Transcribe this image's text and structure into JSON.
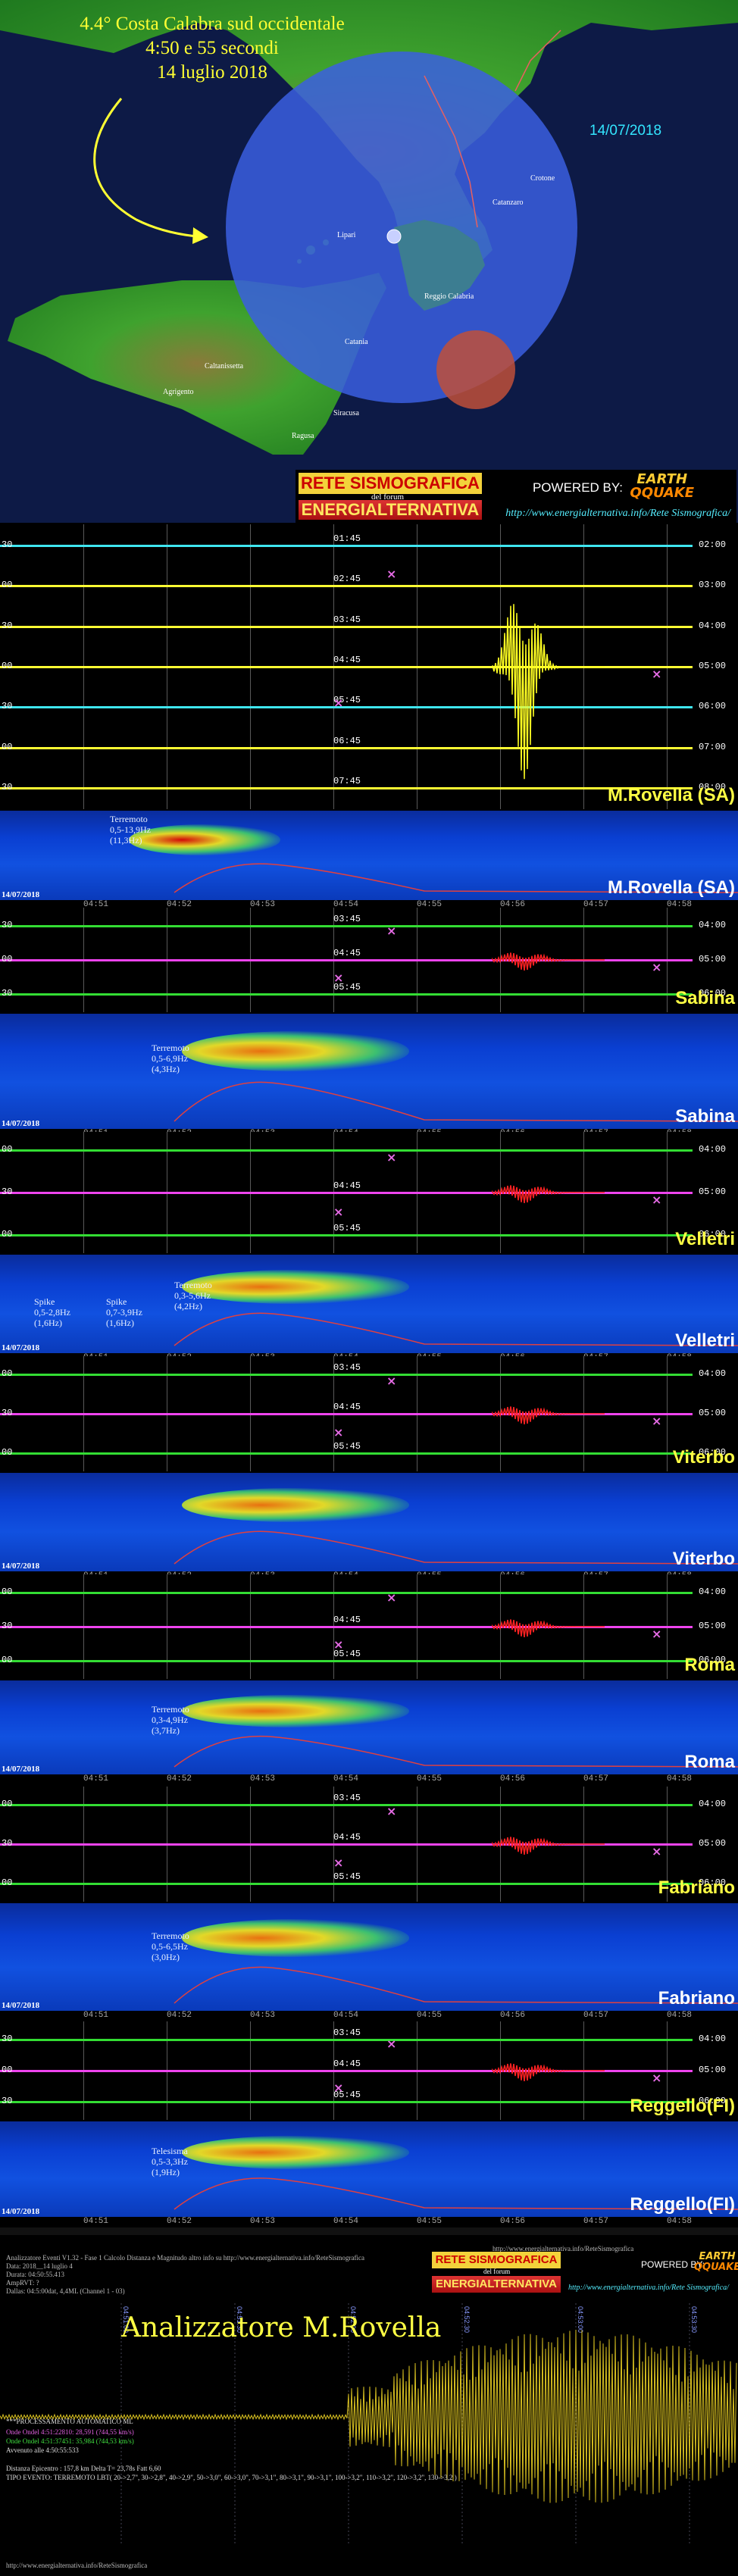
{
  "map": {
    "title_line1": "4.4° Costa Calabra sud occidentale",
    "title_line2": "4:50 e 55 secondi",
    "title_line3": "14 luglio 2018",
    "date": "14/07/2018",
    "place_labels": [
      "Catanzaro",
      "Reggio Calabria",
      "Catania",
      "Agrigento",
      "Caltanissetta",
      "Siracusa",
      "Ragusa",
      "Crotone",
      "Lipari"
    ],
    "banner": {
      "logo_top": "RETE SISMOGRAFICA",
      "logo_mid": "del forum",
      "logo_bottom": "ENERGIALTERNATIVA",
      "powered_by": "POWERED BY:",
      "eq_logo_1": "EARTH",
      "eq_logo_2": "QQUAKE",
      "url": "http://www.energialternativa.info/Rete Sismografica/"
    },
    "colors": {
      "sea": "#0d1a46",
      "land": "#3a9a2a",
      "circle": "#3b5fe0",
      "epicenter": "#c0503a"
    }
  },
  "stations": [
    {
      "name": "M.Rovella (SA)",
      "spec_name": "M.Rovella (SA)",
      "heli_left_ticks": [
        "30",
        "00",
        "30",
        "00",
        "30",
        "00",
        "30"
      ],
      "heli_center_ticks": [
        "01:45",
        "02:45",
        "03:45",
        "04:45",
        "05:45",
        "06:45",
        "07:45"
      ],
      "heli_right_ticks": [
        "02:00",
        "03:00",
        "04:00",
        "05:00",
        "06:00",
        "07:00",
        "08:00"
      ],
      "spec_annotation": [
        "Terremoto",
        "0,5-13,9Hz",
        "(11,3Hz)"
      ],
      "date": "14/07/2018"
    },
    {
      "name": "Sabina",
      "spec_name": "Sabina",
      "heli_left_ticks": [
        "30",
        "00",
        "30"
      ],
      "heli_center_ticks": [
        "03:45",
        "04:45",
        "05:45"
      ],
      "heli_right_ticks": [
        "04:00",
        "05:00",
        "06:00"
      ],
      "spec_annotation": [
        "Terremoto",
        "0,5-6,9Hz",
        "(4,3Hz)"
      ],
      "date": "14/07/2018"
    },
    {
      "name": "Velletri",
      "spec_name": "Velletri",
      "heli_left_ticks": [
        "00",
        "30",
        "00"
      ],
      "heli_center_ticks": [
        "04:45",
        "05:45"
      ],
      "heli_right_ticks": [
        "04:00",
        "05:00",
        "06:00"
      ],
      "spec_annotation": [
        "Terremoto",
        "0,3-5,6Hz",
        "(4,2Hz)"
      ],
      "spec_annotation2": [
        "Spike",
        "0,5-2,8Hz",
        "(1,6Hz)"
      ],
      "spec_annotation3": [
        "Spike",
        "0,7-3,9Hz",
        "(1,6Hz)"
      ],
      "date": "14/07/2018"
    },
    {
      "name": "Viterbo",
      "spec_name": "Viterbo",
      "heli_left_ticks": [
        "00",
        "30",
        "00"
      ],
      "heli_center_ticks": [
        "03:45",
        "04:45",
        "05:45"
      ],
      "heli_right_ticks": [
        "04:00",
        "05:00",
        "06:00"
      ],
      "date": "14/07/2018"
    },
    {
      "name": "Roma",
      "spec_name": "Roma",
      "heli_left_ticks": [
        "00",
        "30",
        "00"
      ],
      "heli_center_ticks": [
        "04:45",
        "05:45"
      ],
      "heli_right_ticks": [
        "04:00",
        "05:00",
        "06:00"
      ],
      "spec_annotation": [
        "Terremoto",
        "0,3-4,9Hz",
        "(3,7Hz)"
      ],
      "date": "14/07/2018"
    },
    {
      "name": "Fabriano",
      "spec_name": "Fabriano",
      "heli_left_ticks": [
        "00",
        "30",
        "00"
      ],
      "heli_center_ticks": [
        "03:45",
        "04:45",
        "05:45"
      ],
      "heli_right_ticks": [
        "04:00",
        "05:00",
        "06:00"
      ],
      "spec_annotation": [
        "Terremoto",
        "0,5-6,5Hz",
        "(3,0Hz)"
      ],
      "date": "14/07/2018"
    },
    {
      "name": "Reggello(FI)",
      "spec_name": "Reggello(FI)",
      "heli_left_ticks": [
        "30",
        "00",
        "30"
      ],
      "heli_center_ticks": [
        "03:45",
        "04:45",
        "05:45"
      ],
      "heli_right_ticks": [
        "04:00",
        "05:00",
        "06:00"
      ],
      "spec_annotation": [
        "Telesisma",
        "0,5-3,3Hz",
        "(1,9Hz)"
      ],
      "date": "14/07/2018"
    }
  ],
  "time_axis": [
    "04:51",
    "04:52",
    "04:53",
    "04:54",
    "04:55",
    "04:56",
    "04:57",
    "04:58"
  ],
  "analyzer": {
    "title": "Analizzatore M.Rovella",
    "url_top": "http://www.energialternativa.info/ReteSismografica",
    "url_bottom": "http://www.energialternativa.info/ReteSismografica",
    "header_lines": [
      "Analizzatore Eventi V1.32 - Fase 1 Calcolo Distanza e Magnitudo altro info su http://www.energialternativa.info/ReteSismografica",
      "Data: 2018__14 luglio 4",
      "Durata: 04:50:55.413",
      "AmpRVT: ?",
      "Dallas: 04:5:00dat, 4,4ML     (Channel 1 - 03)"
    ],
    "onde": [
      "Onde Ondel 4:51:22810: 28,591 (?44,55 km/s)",
      "Onde Ondel 4:51:37451: 35,984 (?44,53 km/s)",
      "Avvenuto alle 4:50:55:533"
    ],
    "auto": "***PROCESSAMENTO AUTOMATICO ML",
    "footer_lines": [
      "Distanza Epicentro : 157,8 km Delta T= 23,78s Fatt 6,60",
      "TIPO EVENTO: TERREMOTO LBT( 20->2,7\", 30->2,8\", 40->2,9\", 50->3,0\", 60->3,0\", 70->3,1\", 80->3,1\", 90->3,1\", 100->3,2\", 110->3,2\", 120->3,2\", 130->3,2 )"
    ],
    "axis_labels": [
      "04:51:00",
      "04:51:30",
      "04:52:00",
      "04:52:30",
      "04:53:00",
      "04:53:30",
      "04:54:00",
      "04:54:30"
    ]
  }
}
